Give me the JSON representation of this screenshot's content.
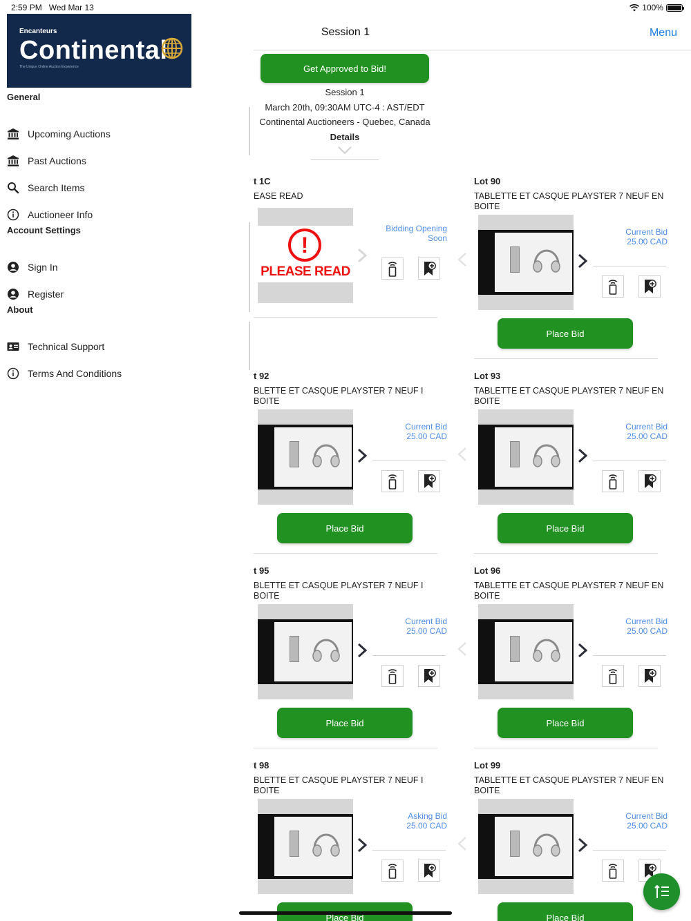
{
  "status_bar": {
    "time": "2:59 PM",
    "date": "Wed Mar 13",
    "battery": "100%",
    "battery_level": 1.0
  },
  "logo": {
    "small": "Encanteurs",
    "big": "Continental",
    "tagline": "The Unique Online Auction Experience"
  },
  "sidebar": {
    "sections": [
      {
        "label": "General",
        "items": [
          {
            "label": "Upcoming Auctions",
            "icon": "bank-icon"
          },
          {
            "label": "Past Auctions",
            "icon": "bank-icon"
          },
          {
            "label": "Search Items",
            "icon": "search-icon"
          },
          {
            "label": "Auctioneer Info",
            "icon": "info-icon"
          }
        ]
      },
      {
        "label": "Account Settings",
        "items": [
          {
            "label": "Sign In",
            "icon": "user-circle-icon"
          },
          {
            "label": "Register",
            "icon": "user-circle-icon"
          }
        ]
      },
      {
        "label": "About",
        "items": [
          {
            "label": "Technical Support",
            "icon": "contact-card-icon"
          },
          {
            "label": "Terms And Conditions",
            "icon": "info-icon"
          }
        ]
      }
    ]
  },
  "header": {
    "title": "Session 1",
    "menu": "Menu"
  },
  "session": {
    "approve_button": "Get Approved to Bid!",
    "name": "Session 1",
    "date": "March 20th, 09:30AM UTC-4 : AST/EDT",
    "location": "Continental Auctioneers - Quebec, Canada",
    "details_label": "Details"
  },
  "colors": {
    "accent_green": "#219121",
    "link_blue": "#1a7ee8",
    "bid_blue": "#4d8ee6",
    "logo_navy": "#13294b"
  },
  "place_bid_label": "Place Bid",
  "lots": [
    {
      "number": "t 1C",
      "title": "EASE READ",
      "bid_label": "Bidding Opening",
      "bid_value": "Soon",
      "image": "please-read",
      "place_bid": false,
      "left_arrow": false
    },
    {
      "number": "Lot 90",
      "title": "TABLETTE ET CASQUE PLAYSTER 7 NEUF EN BOITE",
      "bid_label": "Current Bid",
      "bid_value": "25.00 CAD",
      "image": "product",
      "place_bid": true,
      "left_arrow": true
    },
    {
      "number": "t 92",
      "title": "BLETTE ET CASQUE PLAYSTER 7 NEUF I BOITE",
      "bid_label": "Current Bid",
      "bid_value": "25.00 CAD",
      "image": "product",
      "place_bid": true,
      "left_arrow": false
    },
    {
      "number": "Lot 93",
      "title": "TABLETTE ET CASQUE PLAYSTER 7 NEUF EN BOITE",
      "bid_label": "Current Bid",
      "bid_value": "25.00 CAD",
      "image": "product",
      "place_bid": true,
      "left_arrow": true
    },
    {
      "number": "t 95",
      "title": "BLETTE ET CASQUE PLAYSTER 7 NEUF I BOITE",
      "bid_label": "Current Bid",
      "bid_value": "25.00 CAD",
      "image": "product",
      "place_bid": true,
      "left_arrow": false
    },
    {
      "number": "Lot 96",
      "title": "TABLETTE ET CASQUE PLAYSTER 7 NEUF EN BOITE",
      "bid_label": "Current Bid",
      "bid_value": "25.00 CAD",
      "image": "product",
      "place_bid": true,
      "left_arrow": true
    },
    {
      "number": "t 98",
      "title": "BLETTE ET CASQUE PLAYSTER 7 NEUF I BOITE",
      "bid_label": "Asking Bid",
      "bid_value": "25.00 CAD",
      "image": "product",
      "place_bid": true,
      "left_arrow": false
    },
    {
      "number": "Lot 99",
      "title": "TABLETTE ET CASQUE PLAYSTER 7 NEUF EN BOITE",
      "bid_label": "Current Bid",
      "bid_value": "25.00 CAD",
      "image": "product",
      "place_bid": true,
      "left_arrow": true
    }
  ],
  "fab_icon": "sort-list-icon"
}
